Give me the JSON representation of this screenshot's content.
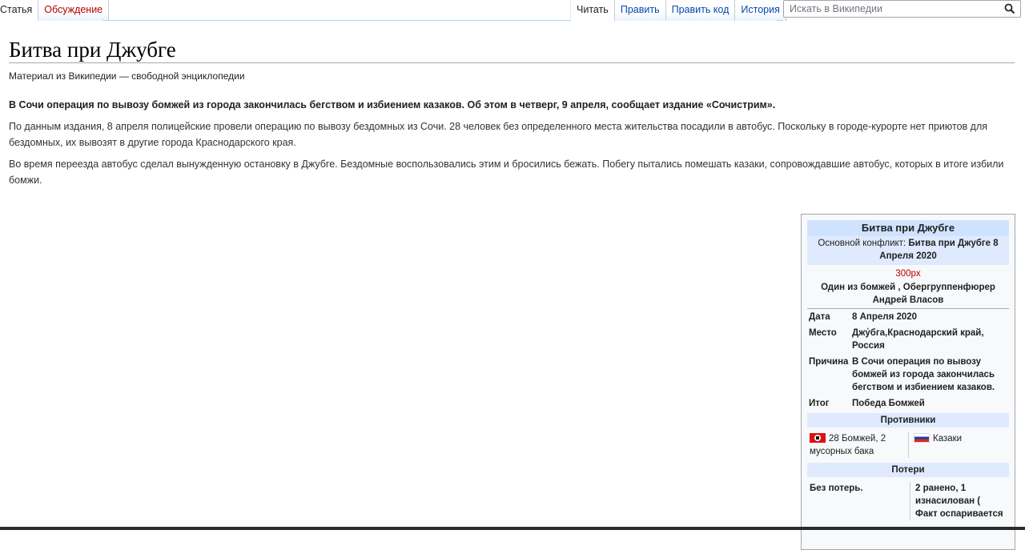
{
  "tabs_left": [
    {
      "label": "Статья",
      "selected": true
    },
    {
      "label": "Обсуждение",
      "selected": false
    }
  ],
  "tabs_right": [
    {
      "label": "Читать",
      "selected": true
    },
    {
      "label": "Править",
      "selected": false
    },
    {
      "label": "Править код",
      "selected": false
    },
    {
      "label": "История",
      "selected": false
    }
  ],
  "search": {
    "placeholder": "Искать в Википедии",
    "icon": "search-icon"
  },
  "article": {
    "title": "Битва при Джубге",
    "tagline": "Материал из Википедии — свободной энциклопедии",
    "lead": "В Сочи операция по вывозу бомжей из города закончилась бегством и избиением казаков. Об этом в четверг, 9 апреля, сообщает издание «Сочистрим».",
    "paragraphs": [
      "По данным издания, 8 апреля полицейские провели операцию по вывозу бездомных из Сочи. 28 человек без определенного места жительства посадили в автобус. Поскольку в городе-курорте нет приютов для бездомных, их вывозят в другие города Краснодарского края.",
      "Во время переезда автобус сделал вынужденную остановку в Джубге. Бездомные воспользовались этим и бросились бежать. Побегу пытались помешать казаки, сопровождавшие автобус, которых в итоге избили бомжи."
    ]
  },
  "infobox": {
    "title": "Битва при Джубге",
    "conflict_label": "Основной конфликт:",
    "conflict_value": "Битва при Джубге 8 Апреля 2020",
    "image_placeholder": "300px",
    "caption": "Один из бомжей , Обергруппенфюрер Андрей Власов",
    "rows": [
      {
        "key": "Дата",
        "value": "8 Апреля 2020"
      },
      {
        "key": "Место",
        "value": "Джу́бга,Краснодарский край, Россия"
      },
      {
        "key": "Причина",
        "value": "В Сочи операция по вывозу бомжей из города закончилась бегством и избиением казаков."
      },
      {
        "key": "Итог",
        "value": "Победа Бомжей"
      }
    ],
    "opponents_header": "Противники",
    "side1": "28 Бомжей, 2 мусорных бака",
    "side2": "Казаки",
    "losses_header": "Потери",
    "loss1": "Без потерь.",
    "loss2": "2 ранено, 1 изнасилован ( Факт оспаривается",
    "colors": {
      "title_bg": "#cfe3ff",
      "section_bg": "#dfeaff",
      "border": "#a2a9b1",
      "link": "#0645ad",
      "redlink": "#ba0000"
    }
  }
}
